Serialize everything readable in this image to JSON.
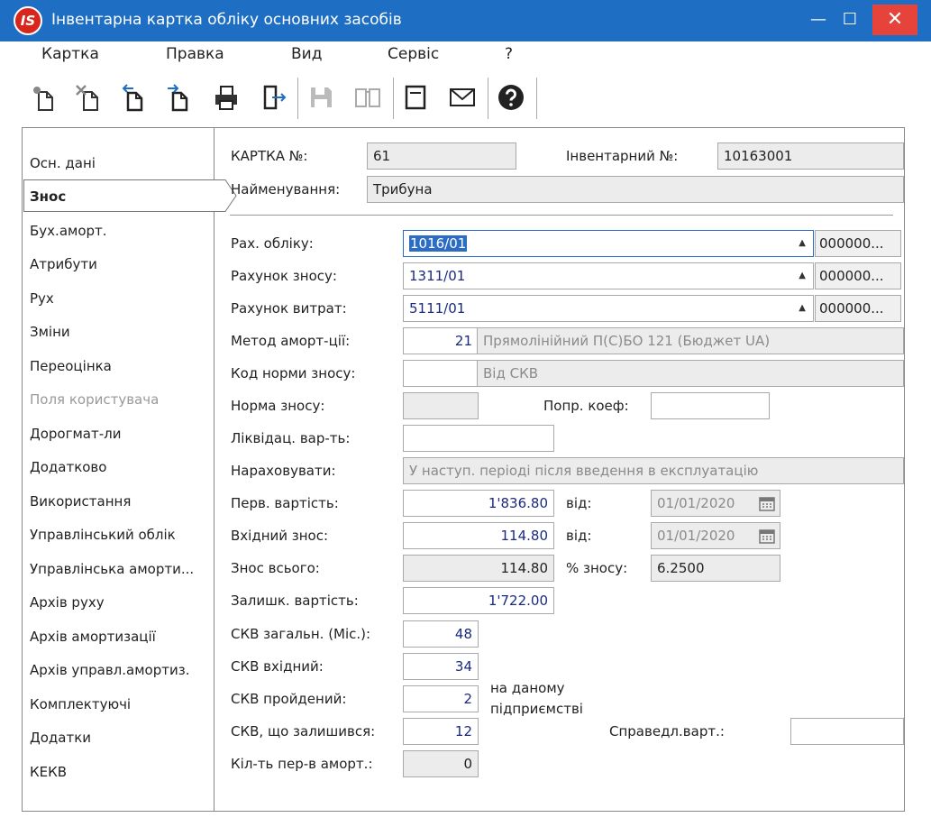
{
  "window": {
    "logo_text": "IS",
    "title": "Інвентарна картка обліку основних засобів",
    "min_symbol": "—",
    "max_symbol": "☐",
    "close_symbol": "✕"
  },
  "menu": [
    "Картка",
    "Правка",
    "Вид",
    "Сервіс",
    "?"
  ],
  "toolbar": [
    {
      "icon": "new-document-icon"
    },
    {
      "icon": "delete-document-icon"
    },
    {
      "icon": "copy-back-icon"
    },
    {
      "icon": "copy-forward-icon"
    },
    {
      "icon": "print-icon"
    },
    {
      "icon": "exit-icon"
    },
    {
      "icon": "save-icon",
      "disabled": true
    },
    {
      "icon": "book-icon",
      "disabled": true
    },
    {
      "icon": "form-icon"
    },
    {
      "icon": "mail-icon"
    },
    {
      "icon": "help-icon"
    }
  ],
  "nav": {
    "items": [
      "Осн. дані",
      "Знос",
      "Бух.аморт.",
      "Атрибути",
      "Рух",
      "Зміни",
      "Переоцінка",
      "Поля користувача",
      "Дорогмат-ли",
      "Додатково",
      "Використання",
      "Управлінський облік",
      "Управлінська аморти...",
      "Архів руху",
      "Архів амортизації",
      "Архів управл.амортиз.",
      "Комплектуючі",
      "Додатки",
      "КЕКВ"
    ],
    "active": "Знос",
    "disabled": "Поля користувача"
  },
  "form": {
    "card_no_label": "КАРТКА №:",
    "card_no": "61",
    "inv_no_label": "Інвентарний №:",
    "inv_no": "10163001",
    "name_label": "Найменування:",
    "name": "Трибуна",
    "acct_label": "Рах. обліку:",
    "acct": "1016/01",
    "acct_extra": "000000...",
    "dep_acct_label": "Рахунок зносу:",
    "dep_acct": "1311/01",
    "dep_acct_extra": "000000...",
    "exp_acct_label": "Рахунок витрат:",
    "exp_acct": "5111/01",
    "exp_acct_extra": "000000...",
    "arrow": "▲",
    "method_label": "Метод аморт-ції:",
    "method_code": "21",
    "method_name": "Прямолінійний П(С)БО 121 (Бюджет UA)",
    "norm_code_label": "Код норми зносу:",
    "norm_code": "",
    "norm_code_text": "Від СКВ",
    "norm_label": "Норма зносу:",
    "norm": "",
    "coef_label": "Попр. коеф:",
    "coef": "",
    "liq_label": "Ліквідац. вар-ть:",
    "liq": "",
    "accrue_label": "Нараховувати:",
    "accrue": "У наступ. періоді після введення в експлуатацію",
    "init_cost_label": "Перв. вартість:",
    "init_cost": "1'836.80",
    "from_label_1": "від:",
    "date_1": "01/01/2020",
    "in_dep_label": "Вхідний знос:",
    "in_dep": "114.80",
    "from_label_2": "від:",
    "date_2": "01/01/2020",
    "total_dep_label": "Знос всього:",
    "total_dep": "114.80",
    "pct_label": "% зносу:",
    "pct": "6.2500",
    "residual_label": "Залишк. вартість:",
    "residual": "1'722.00",
    "skv_total_label": "СКВ загальн. (Міс.):",
    "skv_total": "48",
    "skv_in_label": "СКВ вхідний:",
    "skv_in": "34",
    "skv_passed_label": "СКВ пройдений:",
    "skv_passed": "2",
    "at_enterprise_1": "на даному",
    "at_enterprise_2": "підприємстві",
    "skv_left_label": "СКВ, що залишився:",
    "skv_left": "12",
    "fair_label": "Справедл.варт.:",
    "fair": "",
    "periods_label": "Кіл-ть пер-в аморт.:",
    "periods": "0"
  }
}
